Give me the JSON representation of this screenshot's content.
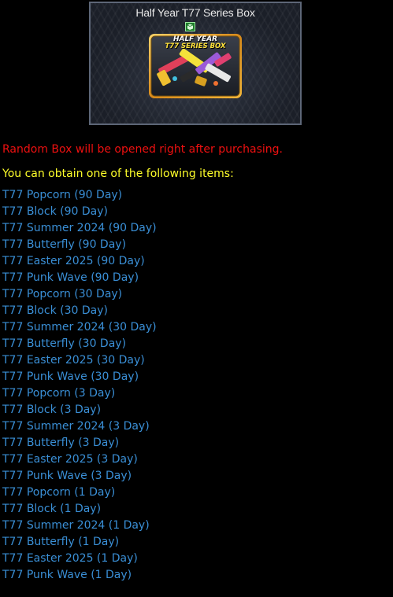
{
  "box": {
    "title": "Half Year T77 Series Box",
    "art_line1": "HALF YEAR",
    "art_line2": "T77 SERIES BOX",
    "badge_icon": "green-box-icon",
    "art_image": "weapon-set-art"
  },
  "notice": "Random Box will be opened right after purchasing.",
  "obtain_label": "You can obtain one of the following items:",
  "items": [
    "T77 Popcorn (90 Day)",
    "T77 Block (90 Day)",
    "T77 Summer 2024 (90 Day)",
    "T77 Butterfly (90 Day)",
    "T77 Easter 2025 (90 Day)",
    "T77 Punk Wave (90 Day)",
    "T77 Popcorn (30 Day)",
    "T77 Block (30 Day)",
    "T77 Summer 2024 (30 Day)",
    "T77 Butterfly (30 Day)",
    "T77 Easter 2025 (30 Day)",
    "T77 Punk Wave (30 Day)",
    "T77 Popcorn (3 Day)",
    "T77 Block (3 Day)",
    "T77 Summer 2024 (3 Day)",
    "T77 Butterfly (3 Day)",
    "T77 Easter 2025 (3 Day)",
    "T77 Punk Wave (3 Day)",
    "T77 Popcorn (1 Day)",
    "T77 Block (1 Day)",
    "T77 Summer 2024 (1 Day)",
    "T77 Butterfly (1 Day)",
    "T77 Easter 2025 (1 Day)",
    "T77 Punk Wave (1 Day)"
  ],
  "colors": {
    "background": "#000000",
    "notice": "#ee1010",
    "obtain_label": "#ffff2a",
    "item_link": "#3a8fd6",
    "card_border": "#5d6677"
  }
}
